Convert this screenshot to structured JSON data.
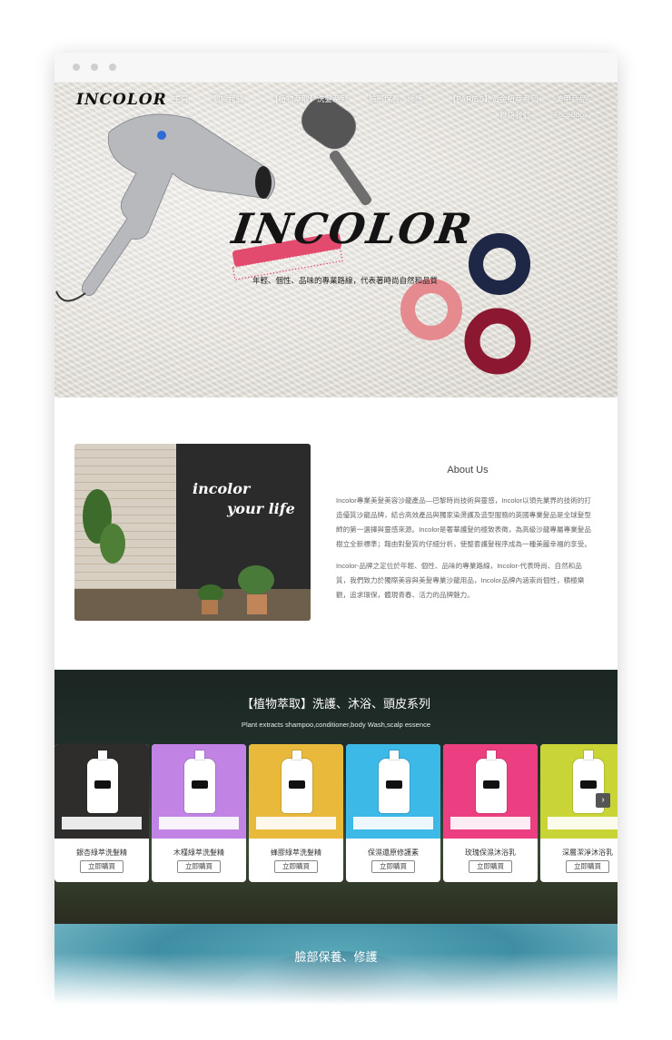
{
  "site": {
    "logo": "INCOLOR",
    "nav": [
      {
        "label": "主頁"
      },
      {
        "label": "關於我們"
      },
      {
        "label": "【植物萃取】洗髮系列"
      },
      {
        "label": "臉部保養、修護"
      },
      {
        "label": "【PARIES】黃金植萃系列"
      },
      {
        "label": "美甲商品"
      },
      {
        "label": "聯絡我們"
      },
      {
        "label": "Facebook"
      }
    ]
  },
  "hero": {
    "title": "INCOLOR",
    "subtitle": "年輕、個性、品味的專業路線，代表著時尚自然和品質"
  },
  "about": {
    "image_text_1": "incolor",
    "image_text_2": "your life",
    "title": "About Us",
    "p1_lines": [
      "Incolor專業美髮美容沙龍產品—巴黎時尚技術與靈感，Incolor以領先業界的技術的打",
      "造優質沙龍品牌，結合高效產品與獨家染燙護及造型服務的英國專業髮品是全球髮型",
      "師的第一選擇與靈感來源。Incolor是奢華護髮的極致表徵，為高級沙龍專屬專業髮品",
      "樹立全新標準；藉由對髮質的仔細分析，使整套護髮程序成為一種美麗幸福的享受。"
    ],
    "p2_lines": [
      "Incolor-品牌之定位於年輕、個性、品味的專業路線，Incolor-代表時尚、自然和品",
      "質，我們致力於獨際美容與美髮專業沙龍用品，Incolor品牌內涵崇尚個性，積極樂",
      "觀，追求環保，體現青春、活力的品牌魅力。"
    ]
  },
  "products": {
    "title": "【植物萃取】洗護、沐浴、頭皮系列",
    "subtitle": "Plant extracts shampoo,conditioner,body Wash,scalp essence",
    "buy_label": "立即購買",
    "next_icon": "chevron-right-icon",
    "items": [
      {
        "name": "銀杏綠萃洗髮精",
        "bg": "#2f2d2b"
      },
      {
        "name": "木槿綠萃洗髮精",
        "bg": "#c184e4"
      },
      {
        "name": "蜂膠綠萃洗髮精",
        "bg": "#e8b93a"
      },
      {
        "name": "保濕還原修護素",
        "bg": "#3db9e8"
      },
      {
        "name": "玫瑰保濕沐浴乳",
        "bg": "#ec3f82"
      },
      {
        "name": "深層潔淨沐浴乳",
        "bg": "#c9d536"
      }
    ]
  },
  "face": {
    "title": "臉部保養、修護"
  }
}
